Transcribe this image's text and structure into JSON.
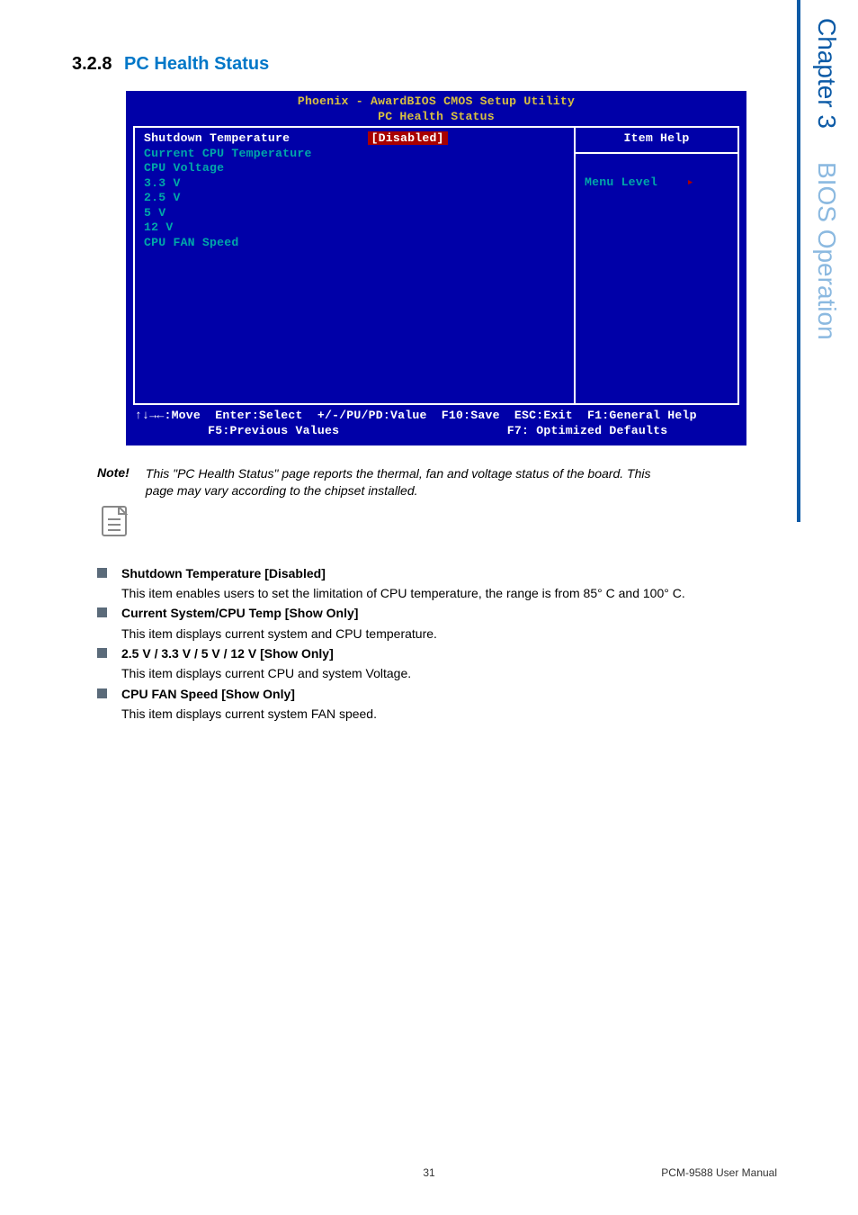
{
  "heading": {
    "num": "3.2.8",
    "title": "PC Health Status"
  },
  "bios": {
    "header1": "Phoenix - AwardBIOS CMOS Setup Utility",
    "header2": "PC Health Status",
    "left": {
      "row0_label": "Shutdown Temperature",
      "row0_value": "[Disabled]",
      "row1": "Current CPU Temperature",
      "row2": "CPU Voltage",
      "row3": "3.3 V",
      "row4": "2.5 V",
      "row5": "5 V",
      "row6": "12 V",
      "row7": "CPU FAN Speed"
    },
    "right": {
      "title": "Item Help",
      "menu": "Menu Level",
      "arrow": "▸"
    },
    "footer1": "↑↓→←:Move  Enter:Select  +/-/PU/PD:Value  F10:Save  ESC:Exit  F1:General Help",
    "footer2": "          F5:Previous Values                       F7: Optimized Defaults"
  },
  "note": {
    "label": "Note!",
    "text": "This \"PC Health Status\" page reports the thermal, fan and voltage status of the board. This page may vary according to the chipset installed."
  },
  "items": [
    {
      "title": "Shutdown Temperature [Disabled]",
      "desc": "This item enables users to set the limitation of CPU temperature, the range is from 85° C and 100° C."
    },
    {
      "title": "Current System/CPU Temp [Show Only]",
      "desc": "This item displays current system and CPU temperature."
    },
    {
      "title": "2.5 V / 3.3 V / 5 V / 12 V [Show Only]",
      "desc": "This item displays current CPU and system Voltage."
    },
    {
      "title": "CPU FAN Speed [Show Only]",
      "desc": "This item displays current system FAN speed."
    }
  ],
  "side": {
    "chapter": "Chapter 3",
    "title": "BIOS Operation"
  },
  "footer": {
    "page": "31",
    "manual": "PCM-9588 User Manual"
  }
}
